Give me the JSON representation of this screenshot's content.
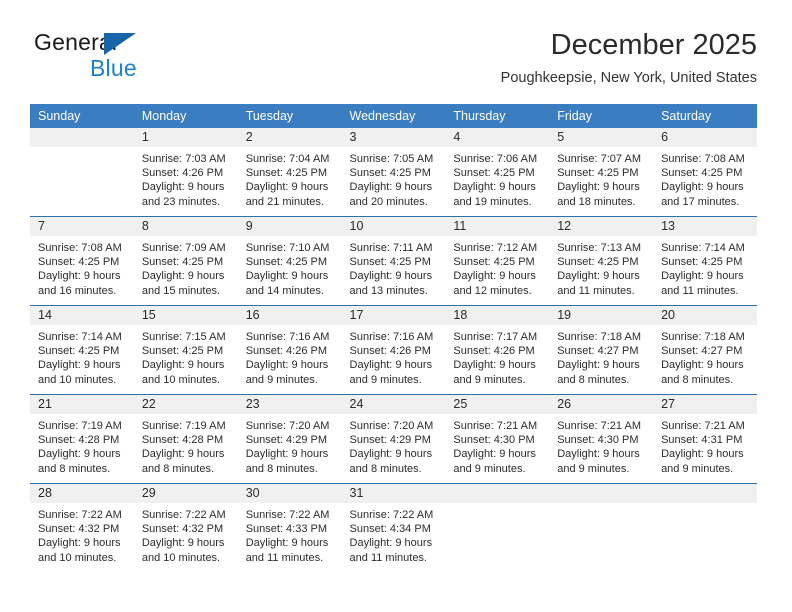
{
  "brand": {
    "line1": "General",
    "line2": "Blue",
    "triangle_color": "#1565a8"
  },
  "header": {
    "title": "December 2025",
    "subtitle": "Poughkeepsie, New York, United States",
    "accent_color": "#3a7dc0"
  },
  "weekday_headers": [
    "Sunday",
    "Monday",
    "Tuesday",
    "Wednesday",
    "Thursday",
    "Friday",
    "Saturday"
  ],
  "weeks": [
    [
      {
        "day": "",
        "sunrise": "",
        "sunset": "",
        "daylight1": "",
        "daylight2": ""
      },
      {
        "day": "1",
        "sunrise": "Sunrise: 7:03 AM",
        "sunset": "Sunset: 4:26 PM",
        "daylight1": "Daylight: 9 hours",
        "daylight2": "and 23 minutes."
      },
      {
        "day": "2",
        "sunrise": "Sunrise: 7:04 AM",
        "sunset": "Sunset: 4:25 PM",
        "daylight1": "Daylight: 9 hours",
        "daylight2": "and 21 minutes."
      },
      {
        "day": "3",
        "sunrise": "Sunrise: 7:05 AM",
        "sunset": "Sunset: 4:25 PM",
        "daylight1": "Daylight: 9 hours",
        "daylight2": "and 20 minutes."
      },
      {
        "day": "4",
        "sunrise": "Sunrise: 7:06 AM",
        "sunset": "Sunset: 4:25 PM",
        "daylight1": "Daylight: 9 hours",
        "daylight2": "and 19 minutes."
      },
      {
        "day": "5",
        "sunrise": "Sunrise: 7:07 AM",
        "sunset": "Sunset: 4:25 PM",
        "daylight1": "Daylight: 9 hours",
        "daylight2": "and 18 minutes."
      },
      {
        "day": "6",
        "sunrise": "Sunrise: 7:08 AM",
        "sunset": "Sunset: 4:25 PM",
        "daylight1": "Daylight: 9 hours",
        "daylight2": "and 17 minutes."
      }
    ],
    [
      {
        "day": "7",
        "sunrise": "Sunrise: 7:08 AM",
        "sunset": "Sunset: 4:25 PM",
        "daylight1": "Daylight: 9 hours",
        "daylight2": "and 16 minutes."
      },
      {
        "day": "8",
        "sunrise": "Sunrise: 7:09 AM",
        "sunset": "Sunset: 4:25 PM",
        "daylight1": "Daylight: 9 hours",
        "daylight2": "and 15 minutes."
      },
      {
        "day": "9",
        "sunrise": "Sunrise: 7:10 AM",
        "sunset": "Sunset: 4:25 PM",
        "daylight1": "Daylight: 9 hours",
        "daylight2": "and 14 minutes."
      },
      {
        "day": "10",
        "sunrise": "Sunrise: 7:11 AM",
        "sunset": "Sunset: 4:25 PM",
        "daylight1": "Daylight: 9 hours",
        "daylight2": "and 13 minutes."
      },
      {
        "day": "11",
        "sunrise": "Sunrise: 7:12 AM",
        "sunset": "Sunset: 4:25 PM",
        "daylight1": "Daylight: 9 hours",
        "daylight2": "and 12 minutes."
      },
      {
        "day": "12",
        "sunrise": "Sunrise: 7:13 AM",
        "sunset": "Sunset: 4:25 PM",
        "daylight1": "Daylight: 9 hours",
        "daylight2": "and 11 minutes."
      },
      {
        "day": "13",
        "sunrise": "Sunrise: 7:14 AM",
        "sunset": "Sunset: 4:25 PM",
        "daylight1": "Daylight: 9 hours",
        "daylight2": "and 11 minutes."
      }
    ],
    [
      {
        "day": "14",
        "sunrise": "Sunrise: 7:14 AM",
        "sunset": "Sunset: 4:25 PM",
        "daylight1": "Daylight: 9 hours",
        "daylight2": "and 10 minutes."
      },
      {
        "day": "15",
        "sunrise": "Sunrise: 7:15 AM",
        "sunset": "Sunset: 4:25 PM",
        "daylight1": "Daylight: 9 hours",
        "daylight2": "and 10 minutes."
      },
      {
        "day": "16",
        "sunrise": "Sunrise: 7:16 AM",
        "sunset": "Sunset: 4:26 PM",
        "daylight1": "Daylight: 9 hours",
        "daylight2": "and 9 minutes."
      },
      {
        "day": "17",
        "sunrise": "Sunrise: 7:16 AM",
        "sunset": "Sunset: 4:26 PM",
        "daylight1": "Daylight: 9 hours",
        "daylight2": "and 9 minutes."
      },
      {
        "day": "18",
        "sunrise": "Sunrise: 7:17 AM",
        "sunset": "Sunset: 4:26 PM",
        "daylight1": "Daylight: 9 hours",
        "daylight2": "and 9 minutes."
      },
      {
        "day": "19",
        "sunrise": "Sunrise: 7:18 AM",
        "sunset": "Sunset: 4:27 PM",
        "daylight1": "Daylight: 9 hours",
        "daylight2": "and 8 minutes."
      },
      {
        "day": "20",
        "sunrise": "Sunrise: 7:18 AM",
        "sunset": "Sunset: 4:27 PM",
        "daylight1": "Daylight: 9 hours",
        "daylight2": "and 8 minutes."
      }
    ],
    [
      {
        "day": "21",
        "sunrise": "Sunrise: 7:19 AM",
        "sunset": "Sunset: 4:28 PM",
        "daylight1": "Daylight: 9 hours",
        "daylight2": "and 8 minutes."
      },
      {
        "day": "22",
        "sunrise": "Sunrise: 7:19 AM",
        "sunset": "Sunset: 4:28 PM",
        "daylight1": "Daylight: 9 hours",
        "daylight2": "and 8 minutes."
      },
      {
        "day": "23",
        "sunrise": "Sunrise: 7:20 AM",
        "sunset": "Sunset: 4:29 PM",
        "daylight1": "Daylight: 9 hours",
        "daylight2": "and 8 minutes."
      },
      {
        "day": "24",
        "sunrise": "Sunrise: 7:20 AM",
        "sunset": "Sunset: 4:29 PM",
        "daylight1": "Daylight: 9 hours",
        "daylight2": "and 8 minutes."
      },
      {
        "day": "25",
        "sunrise": "Sunrise: 7:21 AM",
        "sunset": "Sunset: 4:30 PM",
        "daylight1": "Daylight: 9 hours",
        "daylight2": "and 9 minutes."
      },
      {
        "day": "26",
        "sunrise": "Sunrise: 7:21 AM",
        "sunset": "Sunset: 4:30 PM",
        "daylight1": "Daylight: 9 hours",
        "daylight2": "and 9 minutes."
      },
      {
        "day": "27",
        "sunrise": "Sunrise: 7:21 AM",
        "sunset": "Sunset: 4:31 PM",
        "daylight1": "Daylight: 9 hours",
        "daylight2": "and 9 minutes."
      }
    ],
    [
      {
        "day": "28",
        "sunrise": "Sunrise: 7:22 AM",
        "sunset": "Sunset: 4:32 PM",
        "daylight1": "Daylight: 9 hours",
        "daylight2": "and 10 minutes."
      },
      {
        "day": "29",
        "sunrise": "Sunrise: 7:22 AM",
        "sunset": "Sunset: 4:32 PM",
        "daylight1": "Daylight: 9 hours",
        "daylight2": "and 10 minutes."
      },
      {
        "day": "30",
        "sunrise": "Sunrise: 7:22 AM",
        "sunset": "Sunset: 4:33 PM",
        "daylight1": "Daylight: 9 hours",
        "daylight2": "and 11 minutes."
      },
      {
        "day": "31",
        "sunrise": "Sunrise: 7:22 AM",
        "sunset": "Sunset: 4:34 PM",
        "daylight1": "Daylight: 9 hours",
        "daylight2": "and 11 minutes."
      },
      {
        "day": "",
        "sunrise": "",
        "sunset": "",
        "daylight1": "",
        "daylight2": ""
      },
      {
        "day": "",
        "sunrise": "",
        "sunset": "",
        "daylight1": "",
        "daylight2": ""
      },
      {
        "day": "",
        "sunrise": "",
        "sunset": "",
        "daylight1": "",
        "daylight2": ""
      }
    ]
  ]
}
